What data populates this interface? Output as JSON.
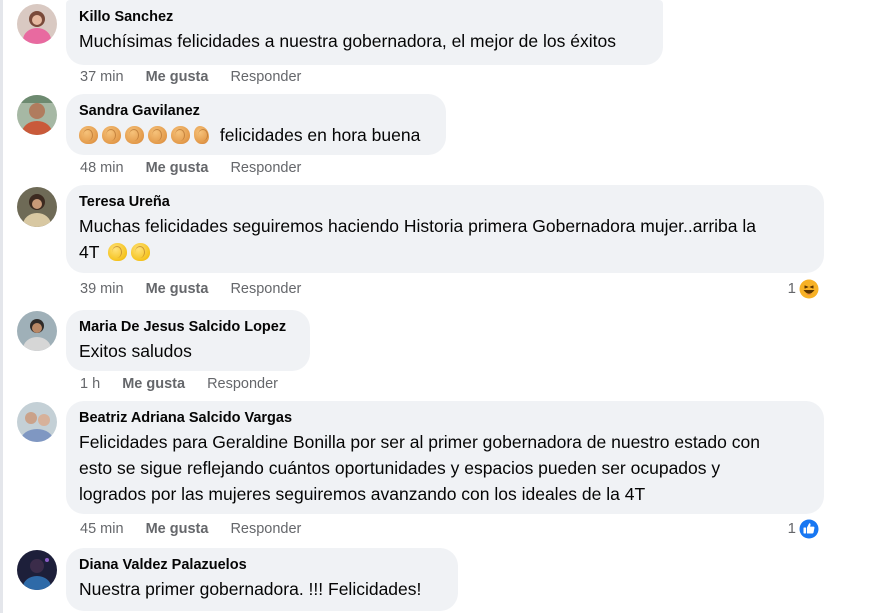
{
  "comments": [
    {
      "author": "Killo Sanchez",
      "text": "Muchísimas felicidades a nuestra gobernadora, el mejor de los éxitos",
      "time": "37 min",
      "like_label": "Me gusta",
      "reply_label": "Responder"
    },
    {
      "author": "Sandra Gavilanez",
      "text": "felicidades en hora buena",
      "emoji_prefix": "clapping-hands-x6",
      "time": "48 min",
      "like_label": "Me gusta",
      "reply_label": "Responder"
    },
    {
      "author": "Teresa Ureña",
      "text_line1": "Muchas felicidades seguiremos haciendo Historia primera Gobernadora mujer..arriba la",
      "text_line2": "4T",
      "emoji_suffix": "clapping-hands-x2",
      "time": "39 min",
      "like_label": "Me gusta",
      "reply_label": "Responder",
      "reaction_count": "1",
      "reaction_icon": "laughing-face-icon"
    },
    {
      "author": "Maria De Jesus Salcido Lopez",
      "text": "Exitos saludos",
      "time": "1 h",
      "like_label": "Me gusta",
      "reply_label": "Responder"
    },
    {
      "author": "Beatriz Adriana Salcido Vargas",
      "text_line1": "Felicidades para Geraldine Bonilla por ser al primer gobernadora de nuestro estado con",
      "text_line2": "esto se sigue reflejando cuántos oportunidades y espacios pueden ser ocupados y",
      "text_line3": "logrados por las mujeres seguiremos avanzando con los ideales de la 4T",
      "time": "45 min",
      "like_label": "Me gusta",
      "reply_label": "Responder",
      "reaction_count": "1",
      "reaction_icon": "thumbs-up-icon"
    },
    {
      "author": "Diana Valdez Palazuelos",
      "text": "Nuestra primer gobernadora. !!! Felicidades!"
    }
  ],
  "colors": {
    "bubble": "#f0f2f5",
    "meta_text": "#65676b",
    "like_blue": "#1877f2",
    "haha_yellow": "#f7b125"
  }
}
